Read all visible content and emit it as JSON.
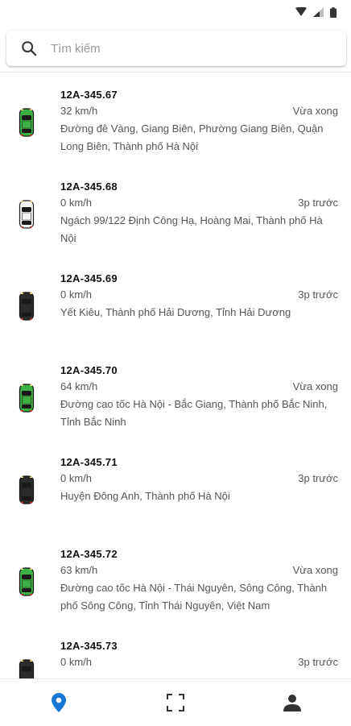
{
  "status_bar": {
    "icons": [
      "wifi-icon",
      "signal-icon",
      "battery-icon"
    ]
  },
  "search": {
    "placeholder": "Tìm kiếm"
  },
  "colors": {
    "accent": "#1976d2",
    "car_green": "#3cb043",
    "car_dark": "#2b2b2b",
    "car_white": "#f4f4f4"
  },
  "vehicles": [
    {
      "plate": "12A-345.67",
      "speed": "32 km/h",
      "time": "Vừa xong",
      "address": "Đường đê Vàng, Giang Biên, Phường Giang Biên, Quận Long Biên, Thành phố Hà Nội",
      "car": "green"
    },
    {
      "plate": "12A-345.68",
      "speed": "0 km/h",
      "time": "3p trước",
      "address": "Ngách 99/122 Định Công Hạ, Hoàng Mai, Thành phố Hà Nội",
      "car": "white"
    },
    {
      "plate": "12A-345.69",
      "speed": "0 km/h",
      "time": "3p trước",
      "address": "Yết Kiêu, Thành phố Hải Dương, Tỉnh Hải Dương",
      "car": "dark"
    },
    {
      "plate": "12A-345.70",
      "speed": "64 km/h",
      "time": "Vừa xong",
      "address": "Đường cao tốc Hà Nội - Bắc Giang, Thành phố Bắc Ninh, Tỉnh Bắc Ninh",
      "car": "green"
    },
    {
      "plate": "12A-345.71",
      "speed": "0 km/h",
      "time": "3p trước",
      "address": "Huyện Đông Anh, Thành phố Hà Nội",
      "car": "dark"
    },
    {
      "plate": "12A-345.72",
      "speed": "63 km/h",
      "time": "Vừa xong",
      "address": "Đường cao tốc Hà Nội - Thái Nguyên, Sông Công, Thành phố Sông Công, Tỉnh Thái Nguyên, Việt Nam",
      "car": "green"
    },
    {
      "plate": "12A-345.73",
      "speed": "0 km/h",
      "time": "3p trước",
      "address": "",
      "car": "dark"
    }
  ],
  "bottom_nav": {
    "items": [
      "map-pin-icon",
      "scan-icon",
      "person-icon"
    ],
    "active": "map-pin-icon"
  }
}
